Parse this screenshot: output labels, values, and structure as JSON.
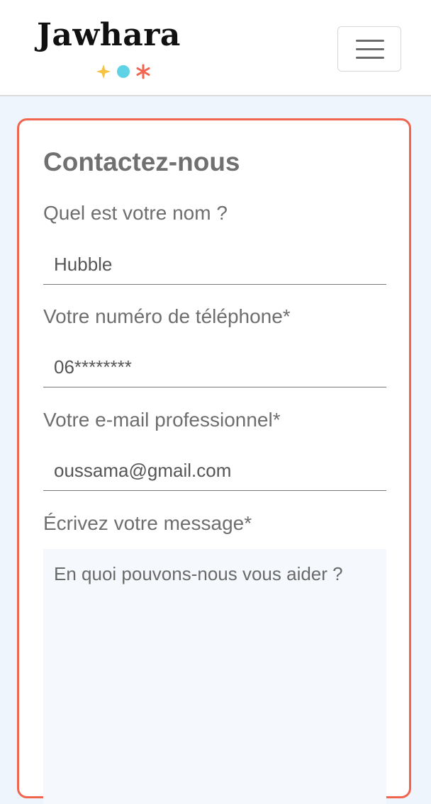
{
  "navbar": {
    "brand": "Jawhara",
    "menu_icon": "hamburger-menu-icon",
    "brand_mark_colors": [
      "#f7c343",
      "#5fd3e6",
      "#f1644e"
    ]
  },
  "form": {
    "title": "Contactez-nous",
    "border_color": "#f1644e",
    "fields": [
      {
        "label": "Quel est votre nom ?",
        "value": "Hubble",
        "placeholder": ""
      },
      {
        "label": "Votre numéro de téléphone*",
        "value": "06********",
        "placeholder": ""
      },
      {
        "label": "Votre e-mail professionnel*",
        "value": "oussama@gmail.com",
        "placeholder": ""
      }
    ],
    "message": {
      "label": "Écrivez votre message*",
      "value": "",
      "placeholder": "En quoi pouvons-nous vous aider ?"
    }
  }
}
